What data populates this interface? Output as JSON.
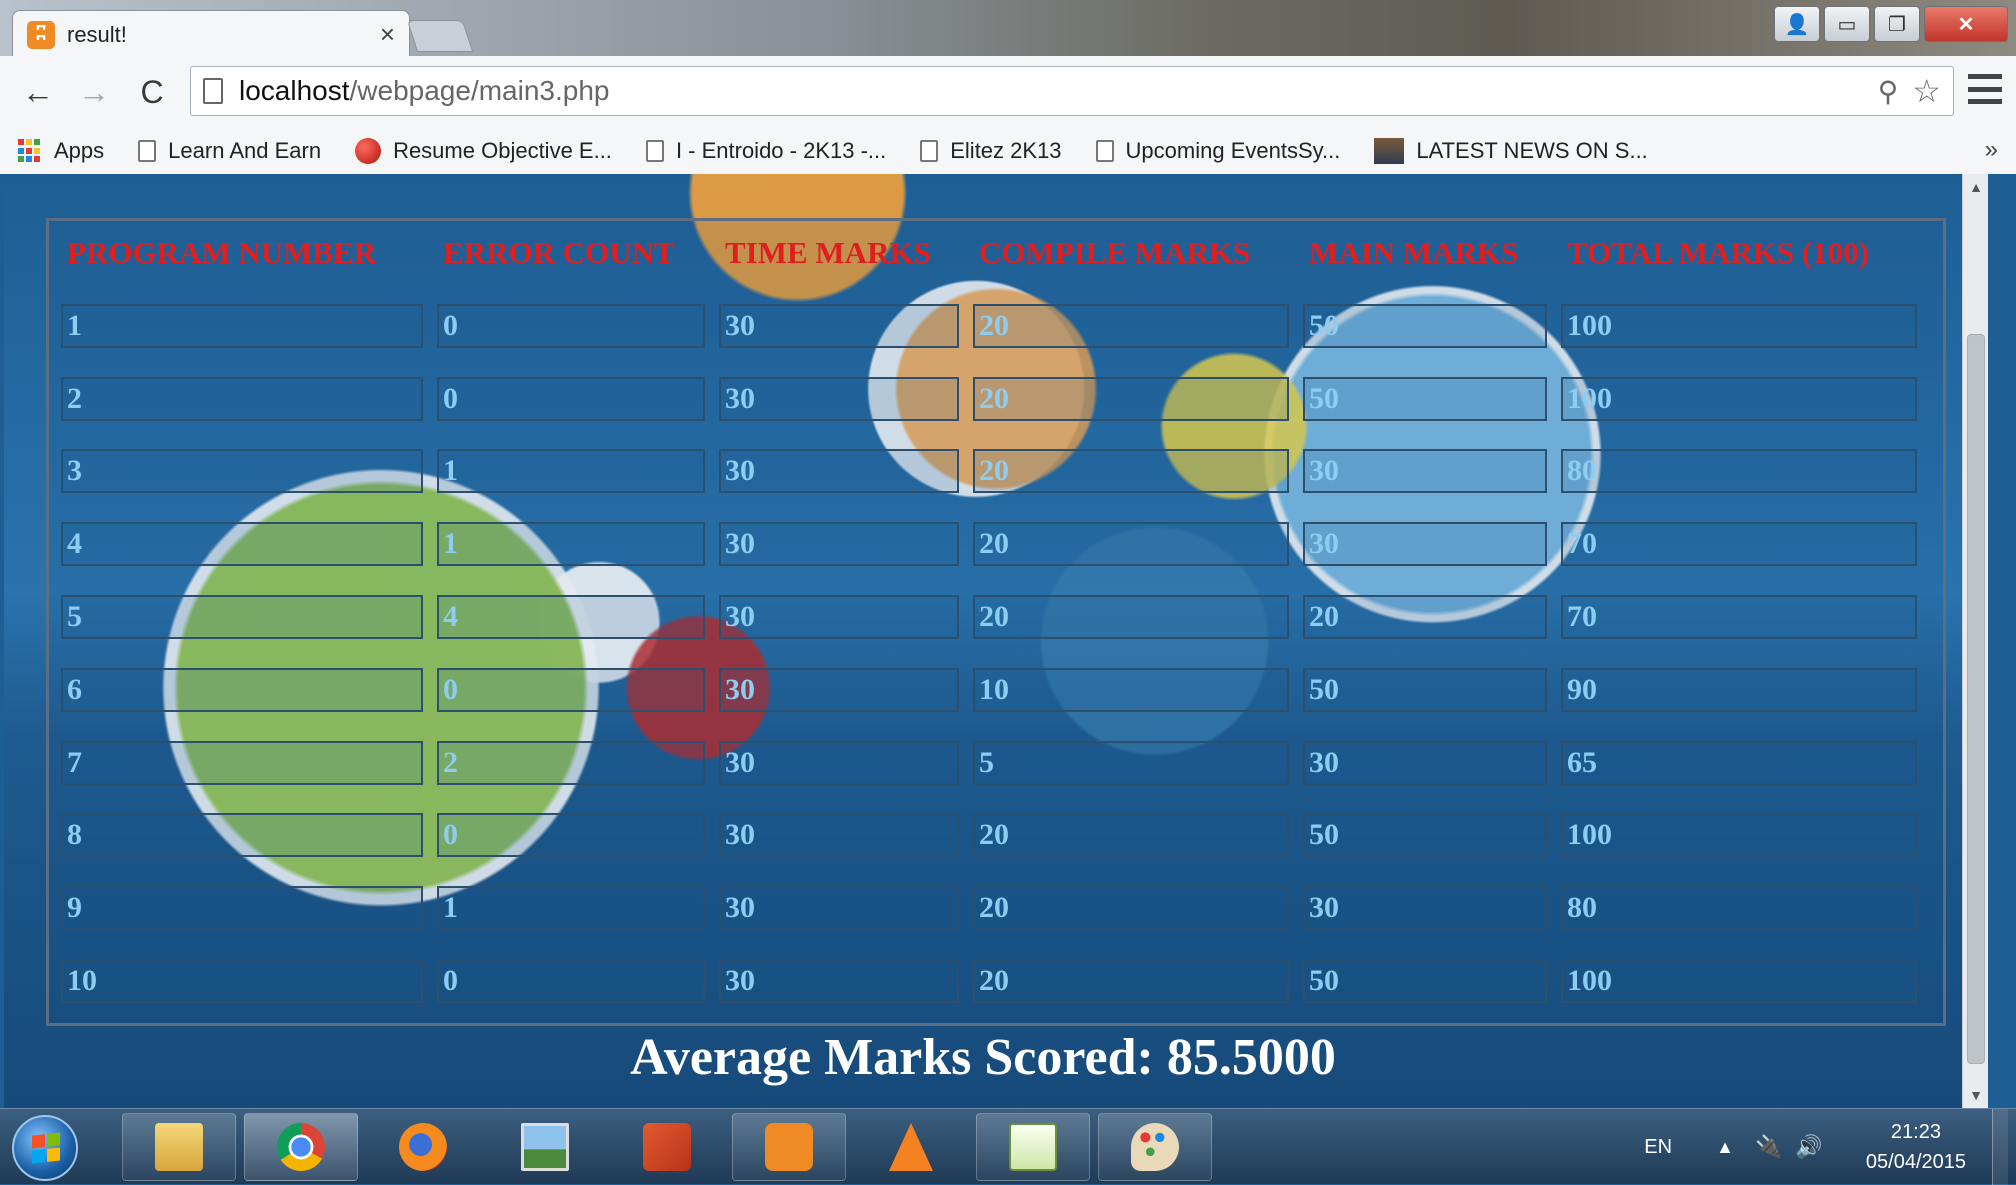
{
  "browser": {
    "tab_title": "result!",
    "tab_close": "×",
    "url_host": "localhost",
    "url_path": "/webpage/main3.php",
    "window_buttons": {
      "user": "👤",
      "minimize": "▭",
      "maximize": "❐",
      "close": "✕"
    },
    "nav": {
      "back": "←",
      "forward": "→",
      "reload": "C"
    },
    "bookmarks": [
      {
        "label": "Apps",
        "icon": "apps-grid-icon"
      },
      {
        "label": "Learn And Earn",
        "icon": "page-icon"
      },
      {
        "label": "Resume Objective E...",
        "icon": "red-circle-icon"
      },
      {
        "label": "I - Entroido - 2K13 -...",
        "icon": "page-icon"
      },
      {
        "label": "Elitez 2K13",
        "icon": "page-icon"
      },
      {
        "label": "Upcoming EventsSy...",
        "icon": "page-icon"
      },
      {
        "label": "LATEST NEWS ON S...",
        "icon": "image-icon"
      }
    ],
    "bookmarks_more": "»"
  },
  "table": {
    "headers": [
      "PROGRAM NUMBER",
      "ERROR COUNT",
      "TIME MARKS",
      "COMPILE MARKS",
      "MAIN MARKS",
      "TOTAL MARKS (100)"
    ],
    "rows": [
      [
        "1",
        "0",
        "30",
        "20",
        "50",
        "100"
      ],
      [
        "2",
        "0",
        "30",
        "20",
        "50",
        "100"
      ],
      [
        "3",
        "1",
        "30",
        "20",
        "30",
        "80"
      ],
      [
        "4",
        "1",
        "30",
        "20",
        "30",
        "70"
      ],
      [
        "5",
        "4",
        "30",
        "20",
        "20",
        "70"
      ],
      [
        "6",
        "0",
        "30",
        "10",
        "50",
        "90"
      ],
      [
        "7",
        "2",
        "30",
        "5",
        "30",
        "65"
      ],
      [
        "8",
        "0",
        "30",
        "20",
        "50",
        "100"
      ],
      [
        "9",
        "1",
        "30",
        "20",
        "30",
        "80"
      ],
      [
        "10",
        "0",
        "30",
        "20",
        "50",
        "100"
      ]
    ]
  },
  "average_text": "Average Marks Scored: 85.5000",
  "taskbar": {
    "apps": [
      "file-explorer-icon",
      "chrome-icon",
      "firefox-icon",
      "photo-viewer-icon",
      "powerpoint-icon",
      "xampp-icon",
      "vlc-icon",
      "notepad-plus-plus-icon",
      "paint-icon"
    ],
    "language": "EN",
    "time": "21:23",
    "date": "05/04/2015"
  },
  "colors": {
    "header_text": "#e01e1e",
    "cell_text": "#8ecdf2",
    "average_text": "#ffffff"
  }
}
